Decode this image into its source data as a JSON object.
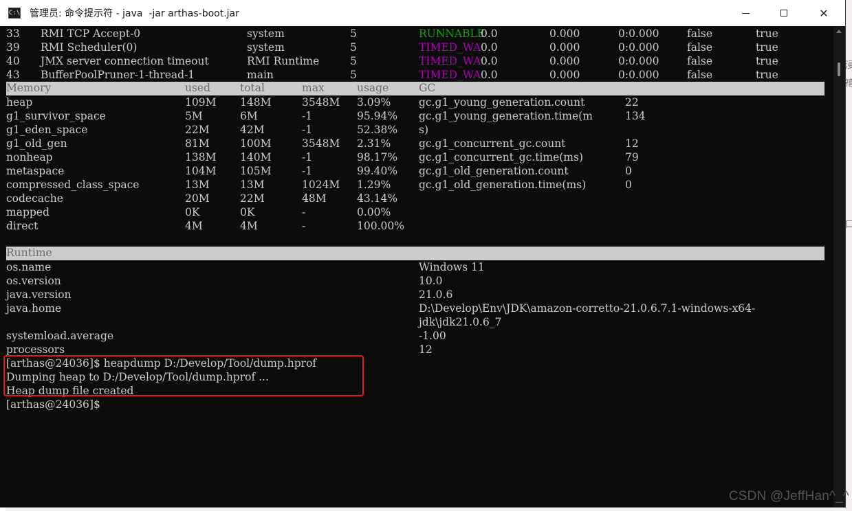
{
  "window": {
    "title": "管理员: 命令提示符 - java  -jar arthas-boot.jar",
    "icon_text": "C:\\"
  },
  "threads": [
    {
      "id": "33",
      "name": "RMI TCP Accept-0",
      "group": "system",
      "priority": "5",
      "state": "RUNNABLE",
      "cpu": "0.0",
      "delta": "0.000",
      "time": "0:0.000",
      "interrupted": "false",
      "daemon": "true"
    },
    {
      "id": "39",
      "name": "RMI Scheduler(0)",
      "group": "system",
      "priority": "5",
      "state": "TIMED_WA",
      "cpu": "0.0",
      "delta": "0.000",
      "time": "0:0.000",
      "interrupted": "false",
      "daemon": "true"
    },
    {
      "id": "40",
      "name": "JMX server connection timeout",
      "group": "RMI Runtime",
      "priority": "5",
      "state": "TIMED_WA",
      "cpu": "0.0",
      "delta": "0.000",
      "time": "0:0.000",
      "interrupted": "false",
      "daemon": "true"
    },
    {
      "id": "43",
      "name": "BufferPoolPruner-1-thread-1",
      "group": "main",
      "priority": "5",
      "state": "TIMED_WA",
      "cpu": "0.0",
      "delta": "0.000",
      "time": "0:0.000",
      "interrupted": "false",
      "daemon": "true"
    }
  ],
  "memory": {
    "headers": {
      "name": "Memory",
      "used": "used",
      "total": "total",
      "max": "max",
      "usage": "usage",
      "gc": "GC"
    },
    "rows": [
      {
        "name": "heap",
        "used": "109M",
        "total": "148M",
        "max": "3548M",
        "usage": "3.09%",
        "gc_name": "gc.g1_young_generation.count",
        "gc_value": "22"
      },
      {
        "name": "g1_survivor_space",
        "used": "5M",
        "total": "6M",
        "max": "-1",
        "usage": "95.94%",
        "gc_name": "gc.g1_young_generation.time(m",
        "gc_value": "134"
      },
      {
        "name": "g1_eden_space",
        "used": "22M",
        "total": "42M",
        "max": "-1",
        "usage": "52.38%",
        "gc_name": "s)",
        "gc_value": ""
      },
      {
        "name": "g1_old_gen",
        "used": "81M",
        "total": "100M",
        "max": "3548M",
        "usage": "2.31%",
        "gc_name": "gc.g1_concurrent_gc.count",
        "gc_value": "12"
      },
      {
        "name": "nonheap",
        "used": "138M",
        "total": "140M",
        "max": "-1",
        "usage": "98.17%",
        "gc_name": "gc.g1_concurrent_gc.time(ms)",
        "gc_value": "79"
      },
      {
        "name": "metaspace",
        "used": "104M",
        "total": "105M",
        "max": "-1",
        "usage": "99.40%",
        "gc_name": "gc.g1_old_generation.count",
        "gc_value": "0"
      },
      {
        "name": "compressed_class_space",
        "used": "13M",
        "total": "13M",
        "max": "1024M",
        "usage": "1.29%",
        "gc_name": "gc.g1_old_generation.time(ms)",
        "gc_value": "0"
      },
      {
        "name": "codecache",
        "used": "20M",
        "total": "22M",
        "max": "48M",
        "usage": "43.14%",
        "gc_name": "",
        "gc_value": ""
      },
      {
        "name": "mapped",
        "used": "0K",
        "total": "0K",
        "max": "-",
        "usage": "0.00%",
        "gc_name": "",
        "gc_value": ""
      },
      {
        "name": "direct",
        "used": "4M",
        "total": "4M",
        "max": "-",
        "usage": "100.00%",
        "gc_name": "",
        "gc_value": ""
      }
    ]
  },
  "runtime": {
    "header": "Runtime",
    "rows": [
      {
        "key": "os.name",
        "value": "Windows 11"
      },
      {
        "key": "os.version",
        "value": "10.0"
      },
      {
        "key": "java.version",
        "value": "21.0.6"
      },
      {
        "key": "java.home",
        "value": "D:\\Develop\\Env\\JDK\\amazon-corretto-21.0.6.7.1-windows-x64-"
      },
      {
        "key": "",
        "value": "jdk\\jdk21.0.6_7"
      },
      {
        "key": "systemload.average",
        "value": "-1.00"
      },
      {
        "key": "processors",
        "value": "12"
      }
    ]
  },
  "console": {
    "lines": [
      "[arthas@24036]$ heapdump D:/Develop/Tool/dump.hprof",
      "Dumping heap to D:/Develop/Tool/dump.hprof ...",
      "Heap dump file created",
      "[arthas@24036]$"
    ]
  },
  "background": {
    "left_fragments": [
      "u",
      "oi",
      "oi",
      "n",
      "it",
      "t",
      "v",
      "t",
      "oi",
      "ch",
      "ct",
      "u",
      "n"
    ],
    "right_fragments": [
      "浸",
      "禧",
      "口"
    ],
    "watermark": "CSDN @JeffHan^_^"
  },
  "colors": {
    "running": "#13a10e",
    "timed_waiting": "#b000b8",
    "highlight": "#e3191b"
  }
}
